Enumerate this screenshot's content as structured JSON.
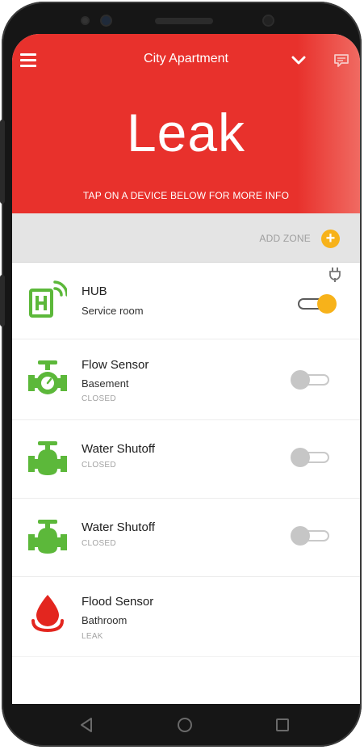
{
  "header": {
    "title": "City Apartment",
    "status": "Leak",
    "hint": "TAP ON A DEVICE BELOW FOR MORE INFO",
    "menu_icon": "hamburger-menu-icon",
    "dropdown_icon": "chevron-down-icon",
    "chat_icon": "chat-icon"
  },
  "zones": {
    "add_label": "ADD ZONE",
    "add_symbol": "+"
  },
  "devices": [
    {
      "name": "HUB",
      "location": "Service room",
      "state": "",
      "icon": "hub-icon",
      "toggle_on": true,
      "power_icon": "plug-icon"
    },
    {
      "name": "Flow Sensor",
      "location": "Basement",
      "state": "CLOSED",
      "icon": "flow-sensor-icon",
      "toggle_on": false
    },
    {
      "name": "Water Shutoff",
      "location": "",
      "state": "CLOSED",
      "icon": "valve-icon",
      "toggle_on": false
    },
    {
      "name": "Water Shutoff",
      "location": "",
      "state": "CLOSED",
      "icon": "valve-icon",
      "toggle_on": false
    },
    {
      "name": "Flood Sensor",
      "location": "Bathroom",
      "state": "LEAK",
      "icon": "water-drop-icon"
    }
  ],
  "colors": {
    "header_red": "#e8312c",
    "accent_yellow": "#f7b21a",
    "device_green": "#5cb83a",
    "flood_red": "#e3261f"
  },
  "nav": [
    "back-icon",
    "home-icon",
    "recents-icon"
  ]
}
